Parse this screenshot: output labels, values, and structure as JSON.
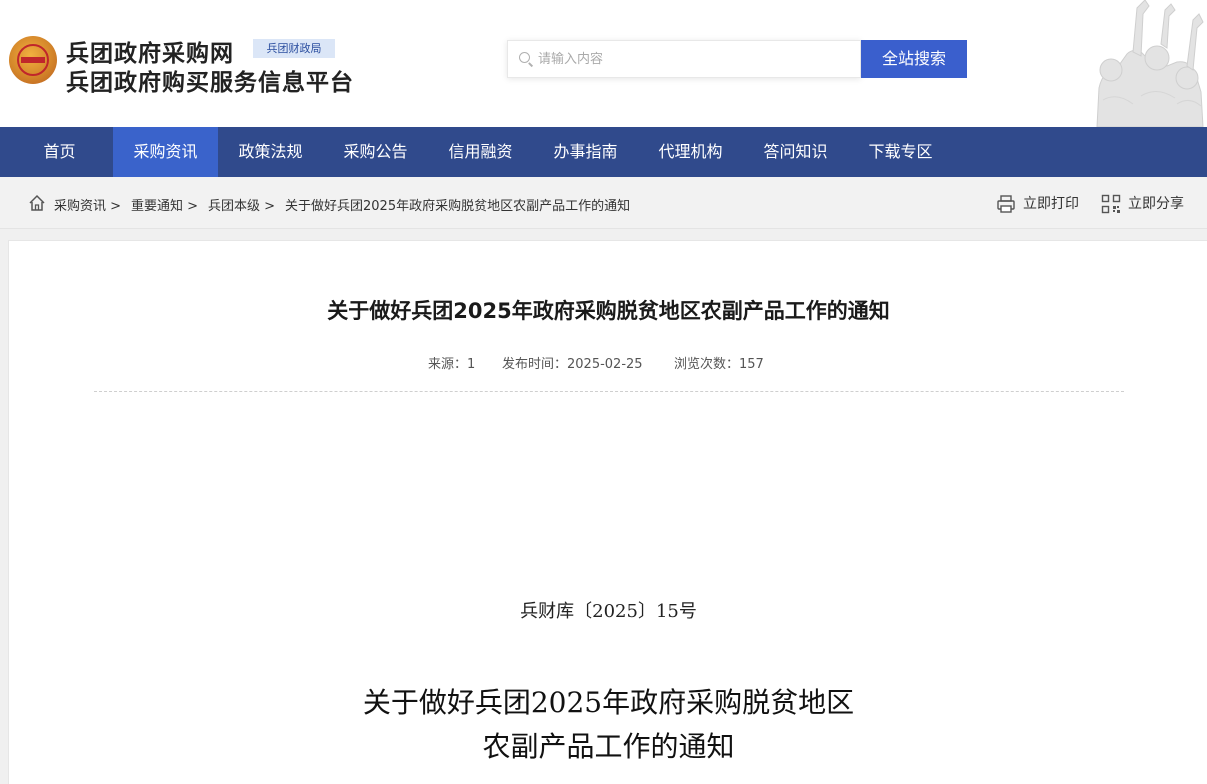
{
  "header": {
    "title_line1": "兵团政府采购网",
    "title_line2": "兵团政府购买服务信息平台",
    "badge": "兵团财政局",
    "search_placeholder": "请输入内容",
    "search_button": "全站搜索"
  },
  "nav": {
    "items": [
      {
        "label": "首页",
        "active": false
      },
      {
        "label": "采购资讯",
        "active": true
      },
      {
        "label": "政策法规",
        "active": false
      },
      {
        "label": "采购公告",
        "active": false
      },
      {
        "label": "信用融资",
        "active": false
      },
      {
        "label": "办事指南",
        "active": false
      },
      {
        "label": "代理机构",
        "active": false
      },
      {
        "label": "答问知识",
        "active": false
      },
      {
        "label": "下载专区",
        "active": false
      }
    ]
  },
  "breadcrumb": {
    "items": [
      "采购资讯 >",
      "重要通知 >",
      "兵团本级 >",
      "关于做好兵团2025年政府采购脱贫地区农副产品工作的通知"
    ]
  },
  "tools": {
    "print": "立即打印",
    "share": "立即分享"
  },
  "article": {
    "title": "关于做好兵团2025年政府采购脱贫地区农副产品工作的通知",
    "source": "来源：1",
    "publish_time": "发布时间：2025-02-25",
    "views": "浏览次数：157",
    "doc_number": "兵财库〔2025〕15号",
    "body_title_line1": "关于做好兵团2025年政府采购脱贫地区",
    "body_title_line2": "农副产品工作的通知"
  },
  "colors": {
    "nav_bg": "#304a8c",
    "nav_active": "#3a63cb",
    "search_button": "#3a5fcd",
    "badge_bg": "#dbe6f7"
  }
}
